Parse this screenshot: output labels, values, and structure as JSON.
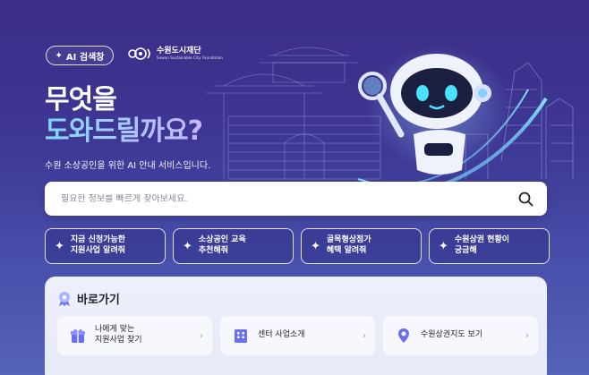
{
  "badge": {
    "label": "AI 검색창",
    "icon": "sparkle-icon"
  },
  "logo": {
    "name": "수원도시재단",
    "sub": "Suwon Sustainable City Foundation"
  },
  "hero": {
    "title_line1": "무엇을",
    "title_line2": "도와드릴까요?",
    "subtitle": "수원 소상공인을 위한 AI 안내 서비스입니다."
  },
  "search": {
    "placeholder": "필요한 정보를 빠르게 찾아보세요.",
    "icon": "search-icon"
  },
  "chips": [
    {
      "label": "지금 신청가능한\n지원사업 알려줘"
    },
    {
      "label": "소상공인 교육\n추천해줘"
    },
    {
      "label": "골목형상점가\n혜택 알려줘"
    },
    {
      "label": "수원상권 현황이\n궁금해"
    }
  ],
  "quicklinks": {
    "title": "바로가기",
    "items": [
      {
        "label": "나에게 맞는\n지원사업 찾기",
        "icon": "gift-icon"
      },
      {
        "label": "센터 사업소개",
        "icon": "building-icon"
      },
      {
        "label": "수원상권지도 보기",
        "icon": "map-pin-icon"
      }
    ]
  },
  "colors": {
    "bg_top": "#3a2d86",
    "bg_bottom": "#5563b8",
    "title_gradient": "#7fd6ff",
    "panel": "#eef0fb"
  }
}
